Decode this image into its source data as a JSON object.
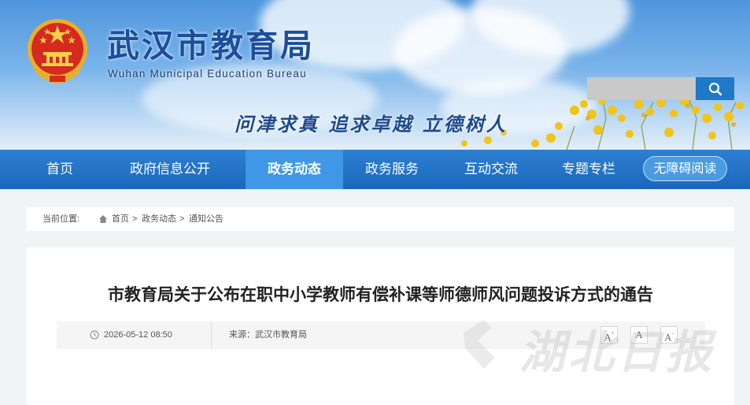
{
  "header": {
    "title_cn": "武汉市教育局",
    "title_en": "Wuhan Municipal Education Bureau",
    "slogan": "问津求真 追求卓越 立德树人"
  },
  "search": {
    "placeholder": "",
    "icon": "search-icon"
  },
  "nav": {
    "items": [
      {
        "label": "首页"
      },
      {
        "label": "政府信息公开"
      },
      {
        "label": "政务动态",
        "active": true
      },
      {
        "label": "政务服务"
      },
      {
        "label": "互动交流"
      },
      {
        "label": "专题专栏"
      }
    ],
    "accessibility": "无障碍阅读",
    "active_color": "#3f97e6",
    "bar_color": "#1a68bd"
  },
  "breadcrumb": {
    "prefix": "当前位置:",
    "items": [
      "首页",
      "政务动态",
      "通知公告"
    ],
    "separator": ">"
  },
  "article": {
    "title": "市教育局关于公布在职中小学教师有偿补课等师德师风问题投诉方式的通告",
    "date": "2026-05-12 08:50",
    "source": "来源：武汉市教育局",
    "font_buttons": [
      {
        "label": "A",
        "sup": "+"
      },
      {
        "label": "A",
        "sup": ""
      },
      {
        "label": "A",
        "sup": "-"
      }
    ]
  },
  "watermark": "湖北日报"
}
